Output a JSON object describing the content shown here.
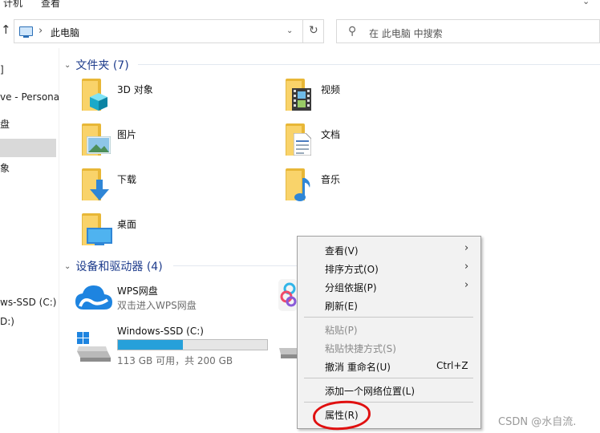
{
  "ribbon": {
    "tab1": "计机",
    "tab2": "查看",
    "expand": "⌄"
  },
  "address": {
    "path": "此电脑",
    "search_placeholder": "在 此电脑 中搜索"
  },
  "nav": {
    "items": [
      "]",
      "ve - Persona",
      "盘",
      "象",
      "ws-SSD (C:)",
      "D:)"
    ]
  },
  "folders_section": {
    "title": "文件夹 (7)",
    "folders": [
      {
        "name": "3D 对象",
        "icon": "3d-objects-icon"
      },
      {
        "name": "视频",
        "icon": "videos-icon"
      },
      {
        "name": "图片",
        "icon": "pictures-icon"
      },
      {
        "name": "文档",
        "icon": "documents-icon"
      },
      {
        "name": "下载",
        "icon": "downloads-icon"
      },
      {
        "name": "音乐",
        "icon": "music-icon"
      },
      {
        "name": "桌面",
        "icon": "desktop-icon"
      }
    ]
  },
  "drives_section": {
    "title": "设备和驱动器 (4)",
    "wps": {
      "name": "WPS网盘",
      "sub": "双击进入WPS网盘"
    },
    "c_drive": {
      "name": "Windows-SSD (C:)",
      "free_text": "113 GB 可用，共 200 GB",
      "used_fraction": 0.435
    }
  },
  "context_menu": {
    "items": [
      {
        "label": "查看(V)",
        "submenu": true,
        "disabled": false
      },
      {
        "label": "排序方式(O)",
        "submenu": true,
        "disabled": false
      },
      {
        "label": "分组依据(P)",
        "submenu": true,
        "disabled": false
      },
      {
        "label": "刷新(E)",
        "submenu": false,
        "disabled": false
      },
      {
        "label": "粘贴(P)",
        "submenu": false,
        "disabled": true
      },
      {
        "label": "粘贴快捷方式(S)",
        "submenu": false,
        "disabled": true
      },
      {
        "label": "撤消 重命名(U)",
        "shortcut": "Ctrl+Z",
        "submenu": false,
        "disabled": false
      },
      {
        "label": "添加一个网络位置(L)",
        "submenu": false,
        "disabled": false
      },
      {
        "label": "属性(R)",
        "submenu": false,
        "disabled": false
      }
    ]
  },
  "annotation": {
    "color": "#e01010"
  },
  "watermark": "CSDN @水自流.",
  "colors": {
    "accent": "#26a0da",
    "group_header": "#1e3c8c",
    "menu_bg": "#f2f2f2"
  }
}
